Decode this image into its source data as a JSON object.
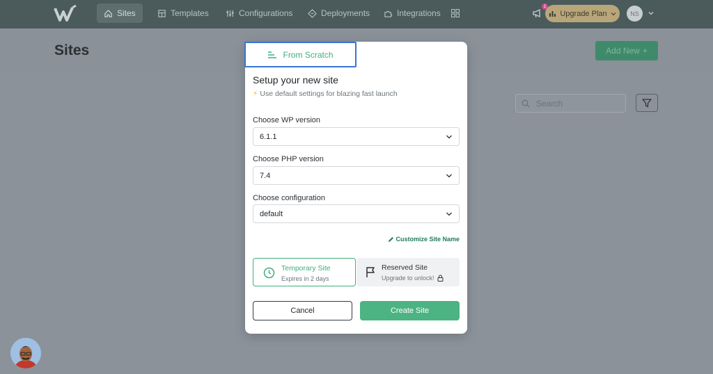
{
  "nav": {
    "items": [
      {
        "label": "Sites",
        "icon": "home-icon"
      },
      {
        "label": "Templates",
        "icon": "template-icon"
      },
      {
        "label": "Configurations",
        "icon": "sliders-icon"
      },
      {
        "label": "Deployments",
        "icon": "deploy-icon"
      },
      {
        "label": "Integrations",
        "icon": "puzzle-icon"
      }
    ],
    "apps_icon": "grid-icon",
    "notification_count": "1",
    "upgrade_label": "Upgrade Plan",
    "user_initials": "NS"
  },
  "page": {
    "title": "Sites",
    "add_new_label": "Add New",
    "search_placeholder": "Search"
  },
  "modal": {
    "tab_label": "From Scratch",
    "title": "Setup your new site",
    "subtitle": "Use default settings for blazing fast launch",
    "wp_label": "Choose WP version",
    "wp_value": "6.1.1",
    "php_label": "Choose PHP version",
    "php_value": "7.4",
    "config_label": "Choose configuration",
    "config_value": "default",
    "customize_label": "Customize Site Name",
    "temporary": {
      "title": "Temporary Site",
      "sub": "Expires in 2 days"
    },
    "reserved": {
      "title": "Reserved Site",
      "sub": "Upgrade to unlock!"
    },
    "cancel_label": "Cancel",
    "create_label": "Create Site"
  },
  "colors": {
    "accent": "#4cb482",
    "nav_bg": "#4b5b5b",
    "tab_border": "#3a73d6"
  }
}
